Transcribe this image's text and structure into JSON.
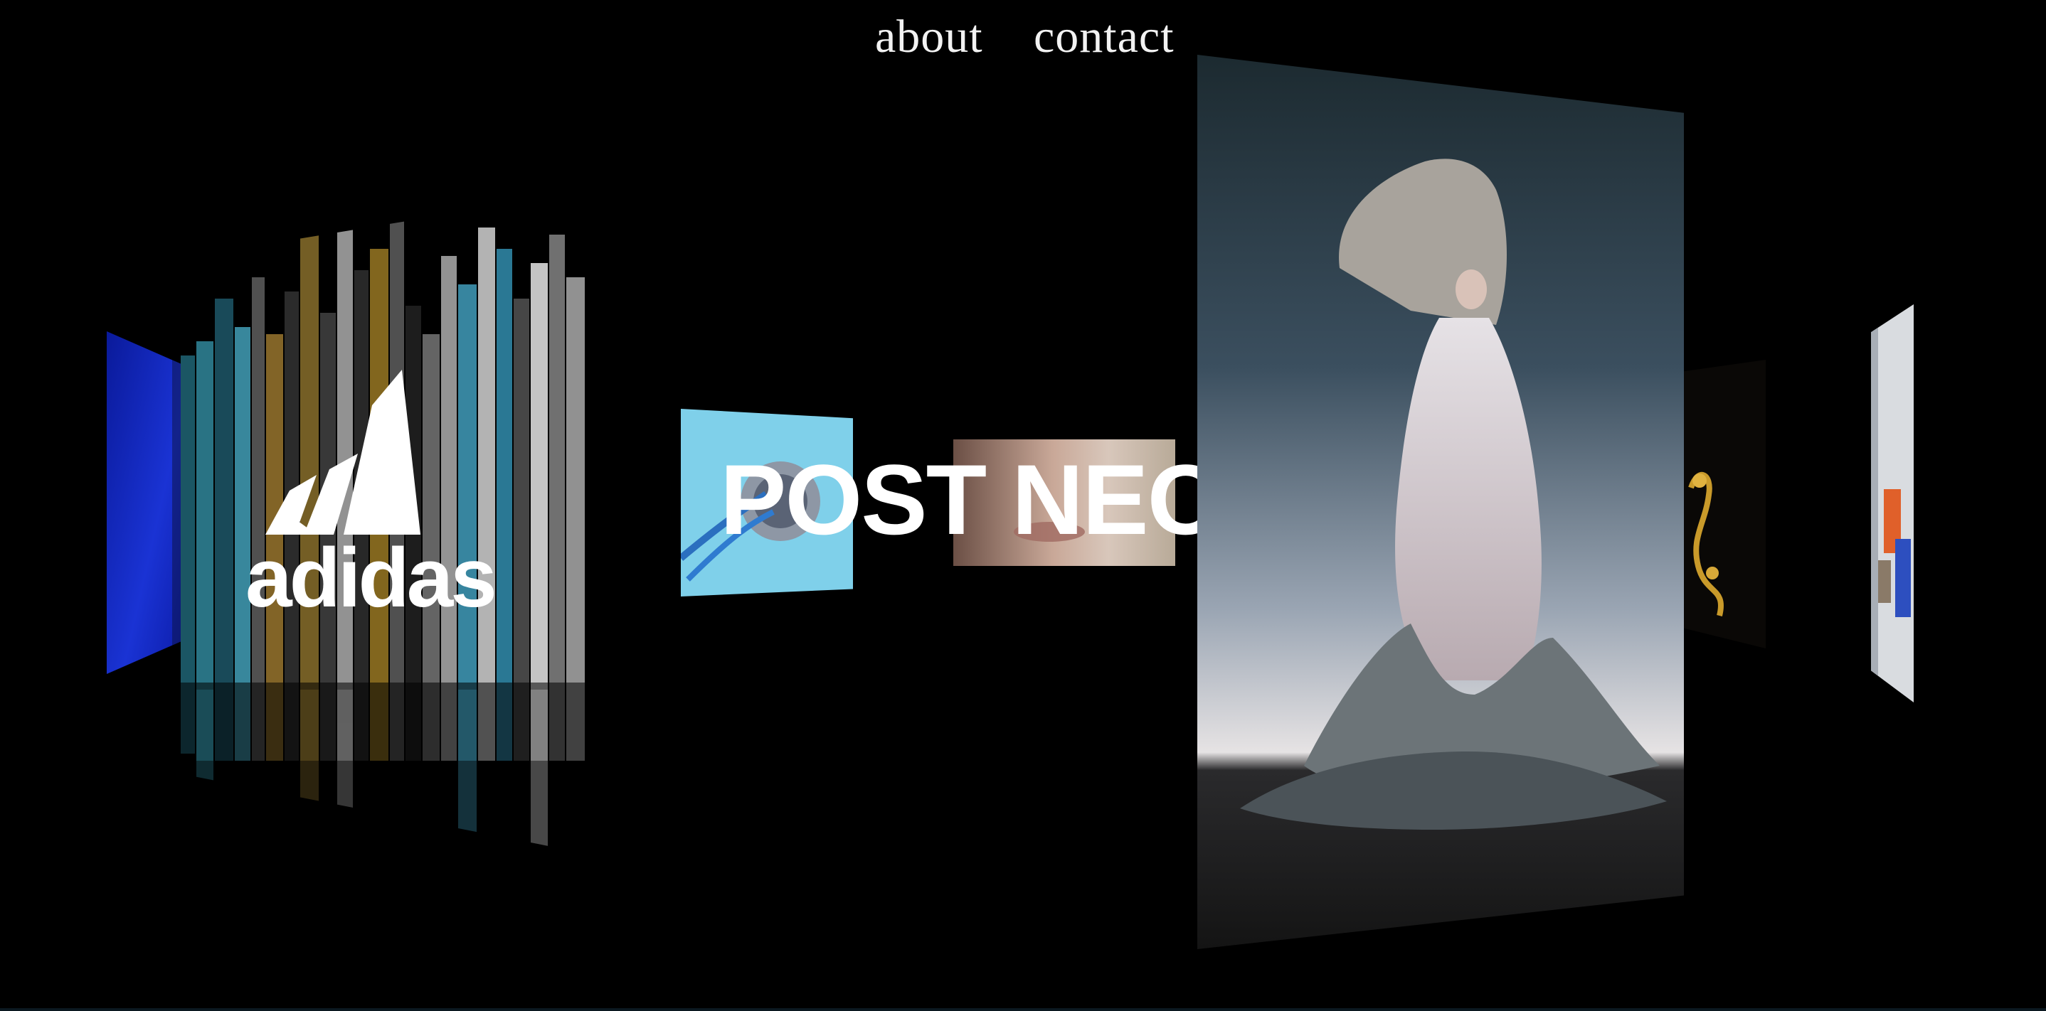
{
  "nav": {
    "about_label": "about",
    "contact_label": "contact"
  },
  "projects": {
    "adidas": {
      "logo_text": "adidas"
    },
    "featured": {
      "title": "POST NEO"
    }
  },
  "colors": {
    "background": "#000000",
    "nav_text": "#f2f2f2",
    "accent_blue": "#1a2fc8",
    "sky_blue": "#7fd0ea"
  }
}
